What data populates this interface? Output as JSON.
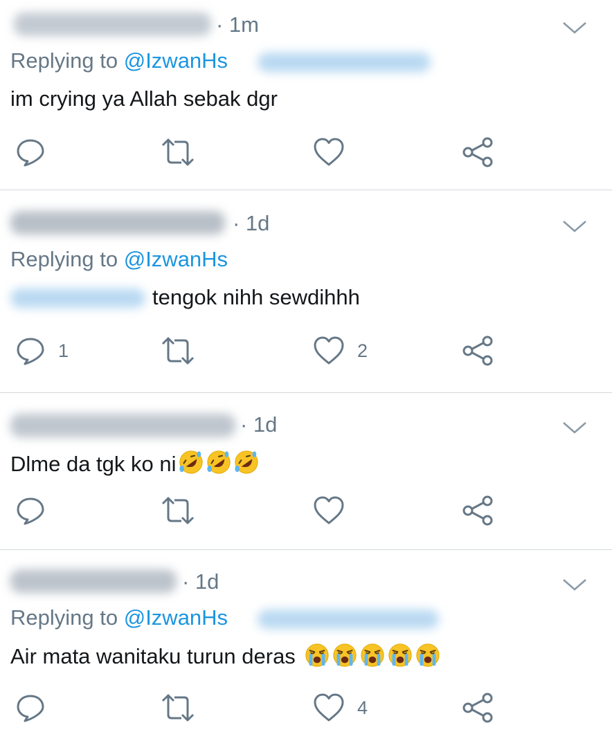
{
  "tweets": [
    {
      "time": "· 1m",
      "replying_prefix": "Replying to ",
      "replying_handle": "@IzwanHs",
      "text": "im crying ya Allah sebak dgr",
      "reply_count": "",
      "like_count": ""
    },
    {
      "time": "· 1d",
      "replying_prefix": "Replying to ",
      "replying_handle": "@IzwanHs",
      "text": "tengok nihh sewdihhh",
      "reply_count": "1",
      "like_count": "2"
    },
    {
      "time": "· 1d",
      "text": "Dlme da tgk ko ni",
      "emoji": "rofl",
      "emoji_count": 3,
      "reply_count": "",
      "like_count": ""
    },
    {
      "time": "· 1d",
      "replying_prefix": "Replying to ",
      "replying_handle": "@IzwanHs",
      "text": "Air mata wanitaku turun deras",
      "emoji": "loudly-crying",
      "emoji_count": 5,
      "reply_count": "",
      "like_count": "4"
    }
  ],
  "icons": [
    "reply-icon",
    "retweet-icon",
    "like-icon",
    "share-icon",
    "chevron-down-icon"
  ],
  "colors": {
    "secondary_text": "#657786",
    "link": "#1b95e0",
    "divider": "#d4d9de",
    "emoji": "#f7c325"
  }
}
